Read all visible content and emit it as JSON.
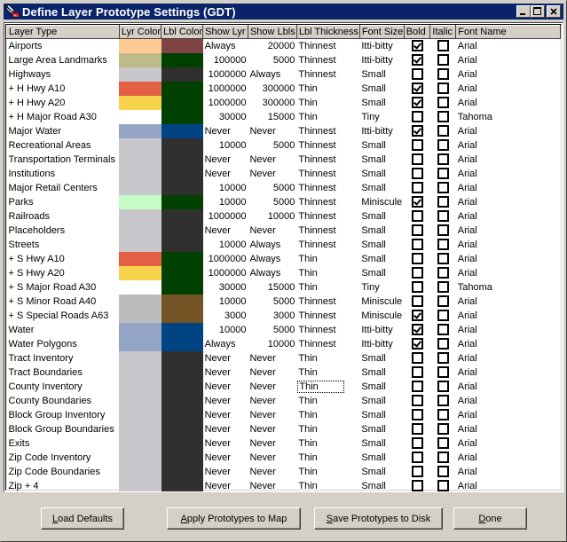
{
  "window": {
    "title": "Define Layer Prototype Settings (GDT)",
    "controls": {
      "minimize": "_",
      "maximize": "□",
      "close": "✕"
    }
  },
  "grid": {
    "columns": [
      "Layer Type",
      "Lyr Color",
      "Lbl Color",
      "Show Lyr",
      "Show Lbls",
      "Lbl Thickness",
      "Font Size",
      "Bold",
      "Italic",
      "Font Name"
    ],
    "focused_cell": {
      "row": 24,
      "column": "Lbl Thickness"
    },
    "rows": [
      {
        "layer": "Airports",
        "lyr_color": "#fecb94",
        "lbl_color": "#804444",
        "show_lyr": "Always",
        "show_lbls": "20000",
        "thickness": "Thinnest",
        "font_size": "Itti-bitty",
        "bold": true,
        "italic": false,
        "font": "Arial"
      },
      {
        "layer": "Large Area Landmarks",
        "lyr_color": "#bcbc88",
        "lbl_color": "#004000",
        "show_lyr": "100000",
        "show_lbls": "5000",
        "thickness": "Thinnest",
        "font_size": "Itti-bitty",
        "bold": true,
        "italic": false,
        "font": "Arial"
      },
      {
        "layer": "Highways",
        "lyr_color": "#c8c8cc",
        "lbl_color": "#303030",
        "show_lyr": "1000000",
        "show_lbls": "Always",
        "thickness": "Thinnest",
        "font_size": "Small",
        "bold": false,
        "italic": false,
        "font": "Arial"
      },
      {
        "layer": " + H Hwy A10",
        "lyr_color": "#e46044",
        "lbl_color": "#004000",
        "show_lyr": "1000000",
        "show_lbls": "300000",
        "thickness": "Thin",
        "font_size": "Small",
        "bold": true,
        "italic": false,
        "font": "Arial"
      },
      {
        "layer": " + H Hwy A20",
        "lyr_color": "#f8d44c",
        "lbl_color": "#004000",
        "show_lyr": "1000000",
        "show_lbls": "300000",
        "thickness": "Thin",
        "font_size": "Small",
        "bold": true,
        "italic": false,
        "font": "Arial"
      },
      {
        "layer": " + H Major Road A30",
        "lyr_color": "#ffffff",
        "lbl_color": "#004000",
        "show_lyr": "30000",
        "show_lbls": "15000",
        "thickness": "Thin",
        "font_size": "Tiny",
        "bold": false,
        "italic": false,
        "font": "Tahoma"
      },
      {
        "layer": "Major Water",
        "lyr_color": "#94a4c4",
        "lbl_color": "#004484",
        "show_lyr": "Never",
        "show_lbls": "Never",
        "thickness": "Thinnest",
        "font_size": "Itti-bitty",
        "bold": true,
        "italic": false,
        "font": "Arial"
      },
      {
        "layer": "Recreational Areas",
        "lyr_color": "#c8c8cc",
        "lbl_color": "#303030",
        "show_lyr": "10000",
        "show_lbls": "5000",
        "thickness": "Thinnest",
        "font_size": "Small",
        "bold": false,
        "italic": false,
        "font": "Arial"
      },
      {
        "layer": "Transportation Terminals",
        "lyr_color": "#c8c8cc",
        "lbl_color": "#303030",
        "show_lyr": "Never",
        "show_lbls": "Never",
        "thickness": "Thinnest",
        "font_size": "Small",
        "bold": false,
        "italic": false,
        "font": "Arial"
      },
      {
        "layer": "Institutions",
        "lyr_color": "#c8c8cc",
        "lbl_color": "#303030",
        "show_lyr": "Never",
        "show_lbls": "Never",
        "thickness": "Thinnest",
        "font_size": "Small",
        "bold": false,
        "italic": false,
        "font": "Arial"
      },
      {
        "layer": "Major Retail Centers",
        "lyr_color": "#c8c8cc",
        "lbl_color": "#303030",
        "show_lyr": "10000",
        "show_lbls": "5000",
        "thickness": "Thinnest",
        "font_size": "Small",
        "bold": false,
        "italic": false,
        "font": "Arial"
      },
      {
        "layer": "Parks",
        "lyr_color": "#c4fcc4",
        "lbl_color": "#004000",
        "show_lyr": "10000",
        "show_lbls": "5000",
        "thickness": "Thinnest",
        "font_size": "Miniscule",
        "bold": true,
        "italic": false,
        "font": "Arial"
      },
      {
        "layer": "Railroads",
        "lyr_color": "#c8c8cc",
        "lbl_color": "#303030",
        "show_lyr": "1000000",
        "show_lbls": "10000",
        "thickness": "Thinnest",
        "font_size": "Small",
        "bold": false,
        "italic": false,
        "font": "Arial"
      },
      {
        "layer": "Placeholders",
        "lyr_color": "#c8c8cc",
        "lbl_color": "#303030",
        "show_lyr": "Never",
        "show_lbls": "Never",
        "thickness": "Thinnest",
        "font_size": "Small",
        "bold": false,
        "italic": false,
        "font": "Arial"
      },
      {
        "layer": "Streets",
        "lyr_color": "#c8c8cc",
        "lbl_color": "#303030",
        "show_lyr": "10000",
        "show_lbls": "Always",
        "thickness": "Thinnest",
        "font_size": "Small",
        "bold": false,
        "italic": false,
        "font": "Arial"
      },
      {
        "layer": " + S Hwy A10",
        "lyr_color": "#e46044",
        "lbl_color": "#004000",
        "show_lyr": "1000000",
        "show_lbls": "Always",
        "thickness": "Thin",
        "font_size": "Small",
        "bold": false,
        "italic": false,
        "font": "Arial"
      },
      {
        "layer": " + S Hwy A20",
        "lyr_color": "#f8d44c",
        "lbl_color": "#004000",
        "show_lyr": "1000000",
        "show_lbls": "Always",
        "thickness": "Thin",
        "font_size": "Small",
        "bold": false,
        "italic": false,
        "font": "Arial"
      },
      {
        "layer": " + S Major Road A30",
        "lyr_color": "#ffffff",
        "lbl_color": "#004000",
        "show_lyr": "30000",
        "show_lbls": "15000",
        "thickness": "Thin",
        "font_size": "Tiny",
        "bold": false,
        "italic": false,
        "font": "Tahoma"
      },
      {
        "layer": " + S Minor Road A40",
        "lyr_color": "#bcbcbc",
        "lbl_color": "#745424",
        "show_lyr": "10000",
        "show_lbls": "5000",
        "thickness": "Thinnest",
        "font_size": "Miniscule",
        "bold": false,
        "italic": false,
        "font": "Arial"
      },
      {
        "layer": " + S Special Roads A63",
        "lyr_color": "#bcbcbc",
        "lbl_color": "#745424",
        "show_lyr": "3000",
        "show_lbls": "3000",
        "thickness": "Thinnest",
        "font_size": "Miniscule",
        "bold": true,
        "italic": false,
        "font": "Arial"
      },
      {
        "layer": "Water",
        "lyr_color": "#94a4c4",
        "lbl_color": "#004484",
        "show_lyr": "10000",
        "show_lbls": "5000",
        "thickness": "Thinnest",
        "font_size": "Itti-bitty",
        "bold": true,
        "italic": false,
        "font": "Arial"
      },
      {
        "layer": "Water Polygons",
        "lyr_color": "#94a4c4",
        "lbl_color": "#004484",
        "show_lyr": "Always",
        "show_lbls": "10000",
        "thickness": "Thinnest",
        "font_size": "Itti-bitty",
        "bold": true,
        "italic": false,
        "font": "Arial"
      },
      {
        "layer": "Tract Inventory",
        "lyr_color": "#c8c8cc",
        "lbl_color": "#303030",
        "show_lyr": "Never",
        "show_lbls": "Never",
        "thickness": "Thin",
        "font_size": "Small",
        "bold": false,
        "italic": false,
        "font": "Arial"
      },
      {
        "layer": "Tract Boundaries",
        "lyr_color": "#c8c8cc",
        "lbl_color": "#303030",
        "show_lyr": "Never",
        "show_lbls": "Never",
        "thickness": "Thin",
        "font_size": "Small",
        "bold": false,
        "italic": false,
        "font": "Arial"
      },
      {
        "layer": "County Inventory",
        "lyr_color": "#c8c8cc",
        "lbl_color": "#303030",
        "show_lyr": "Never",
        "show_lbls": "Never",
        "thickness": "Thin",
        "font_size": "Small",
        "bold": false,
        "italic": false,
        "font": "Arial"
      },
      {
        "layer": "County Boundaries",
        "lyr_color": "#c8c8cc",
        "lbl_color": "#303030",
        "show_lyr": "Never",
        "show_lbls": "Never",
        "thickness": "Thin",
        "font_size": "Small",
        "bold": false,
        "italic": false,
        "font": "Arial"
      },
      {
        "layer": "Block Group Inventory",
        "lyr_color": "#c8c8cc",
        "lbl_color": "#303030",
        "show_lyr": "Never",
        "show_lbls": "Never",
        "thickness": "Thin",
        "font_size": "Small",
        "bold": false,
        "italic": false,
        "font": "Arial"
      },
      {
        "layer": "Block Group Boundaries",
        "lyr_color": "#c8c8cc",
        "lbl_color": "#303030",
        "show_lyr": "Never",
        "show_lbls": "Never",
        "thickness": "Thin",
        "font_size": "Small",
        "bold": false,
        "italic": false,
        "font": "Arial"
      },
      {
        "layer": "Exits",
        "lyr_color": "#c8c8cc",
        "lbl_color": "#303030",
        "show_lyr": "Never",
        "show_lbls": "Never",
        "thickness": "Thin",
        "font_size": "Small",
        "bold": false,
        "italic": false,
        "font": "Arial"
      },
      {
        "layer": "Zip Code Inventory",
        "lyr_color": "#c8c8cc",
        "lbl_color": "#303030",
        "show_lyr": "Never",
        "show_lbls": "Never",
        "thickness": "Thin",
        "font_size": "Small",
        "bold": false,
        "italic": false,
        "font": "Arial"
      },
      {
        "layer": "Zip Code Boundaries",
        "lyr_color": "#c8c8cc",
        "lbl_color": "#303030",
        "show_lyr": "Never",
        "show_lbls": "Never",
        "thickness": "Thin",
        "font_size": "Small",
        "bold": false,
        "italic": false,
        "font": "Arial"
      },
      {
        "layer": "Zip + 4",
        "lyr_color": "#c8c8cc",
        "lbl_color": "#303030",
        "show_lyr": "Never",
        "show_lbls": "Never",
        "thickness": "Thin",
        "font_size": "Small",
        "bold": false,
        "italic": false,
        "font": "Arial"
      }
    ]
  },
  "buttons": {
    "load_defaults": {
      "label": "Load Defaults",
      "mnemonic": "L"
    },
    "apply": {
      "label": "Apply Prototypes to Map",
      "mnemonic": "A"
    },
    "save": {
      "label": "Save Prototypes to Disk",
      "mnemonic": "S"
    },
    "done": {
      "label": "Done",
      "mnemonic": "D"
    }
  },
  "colors": {
    "titlebar": "#0a246a",
    "dialog_bg": "#d4d0c8"
  }
}
